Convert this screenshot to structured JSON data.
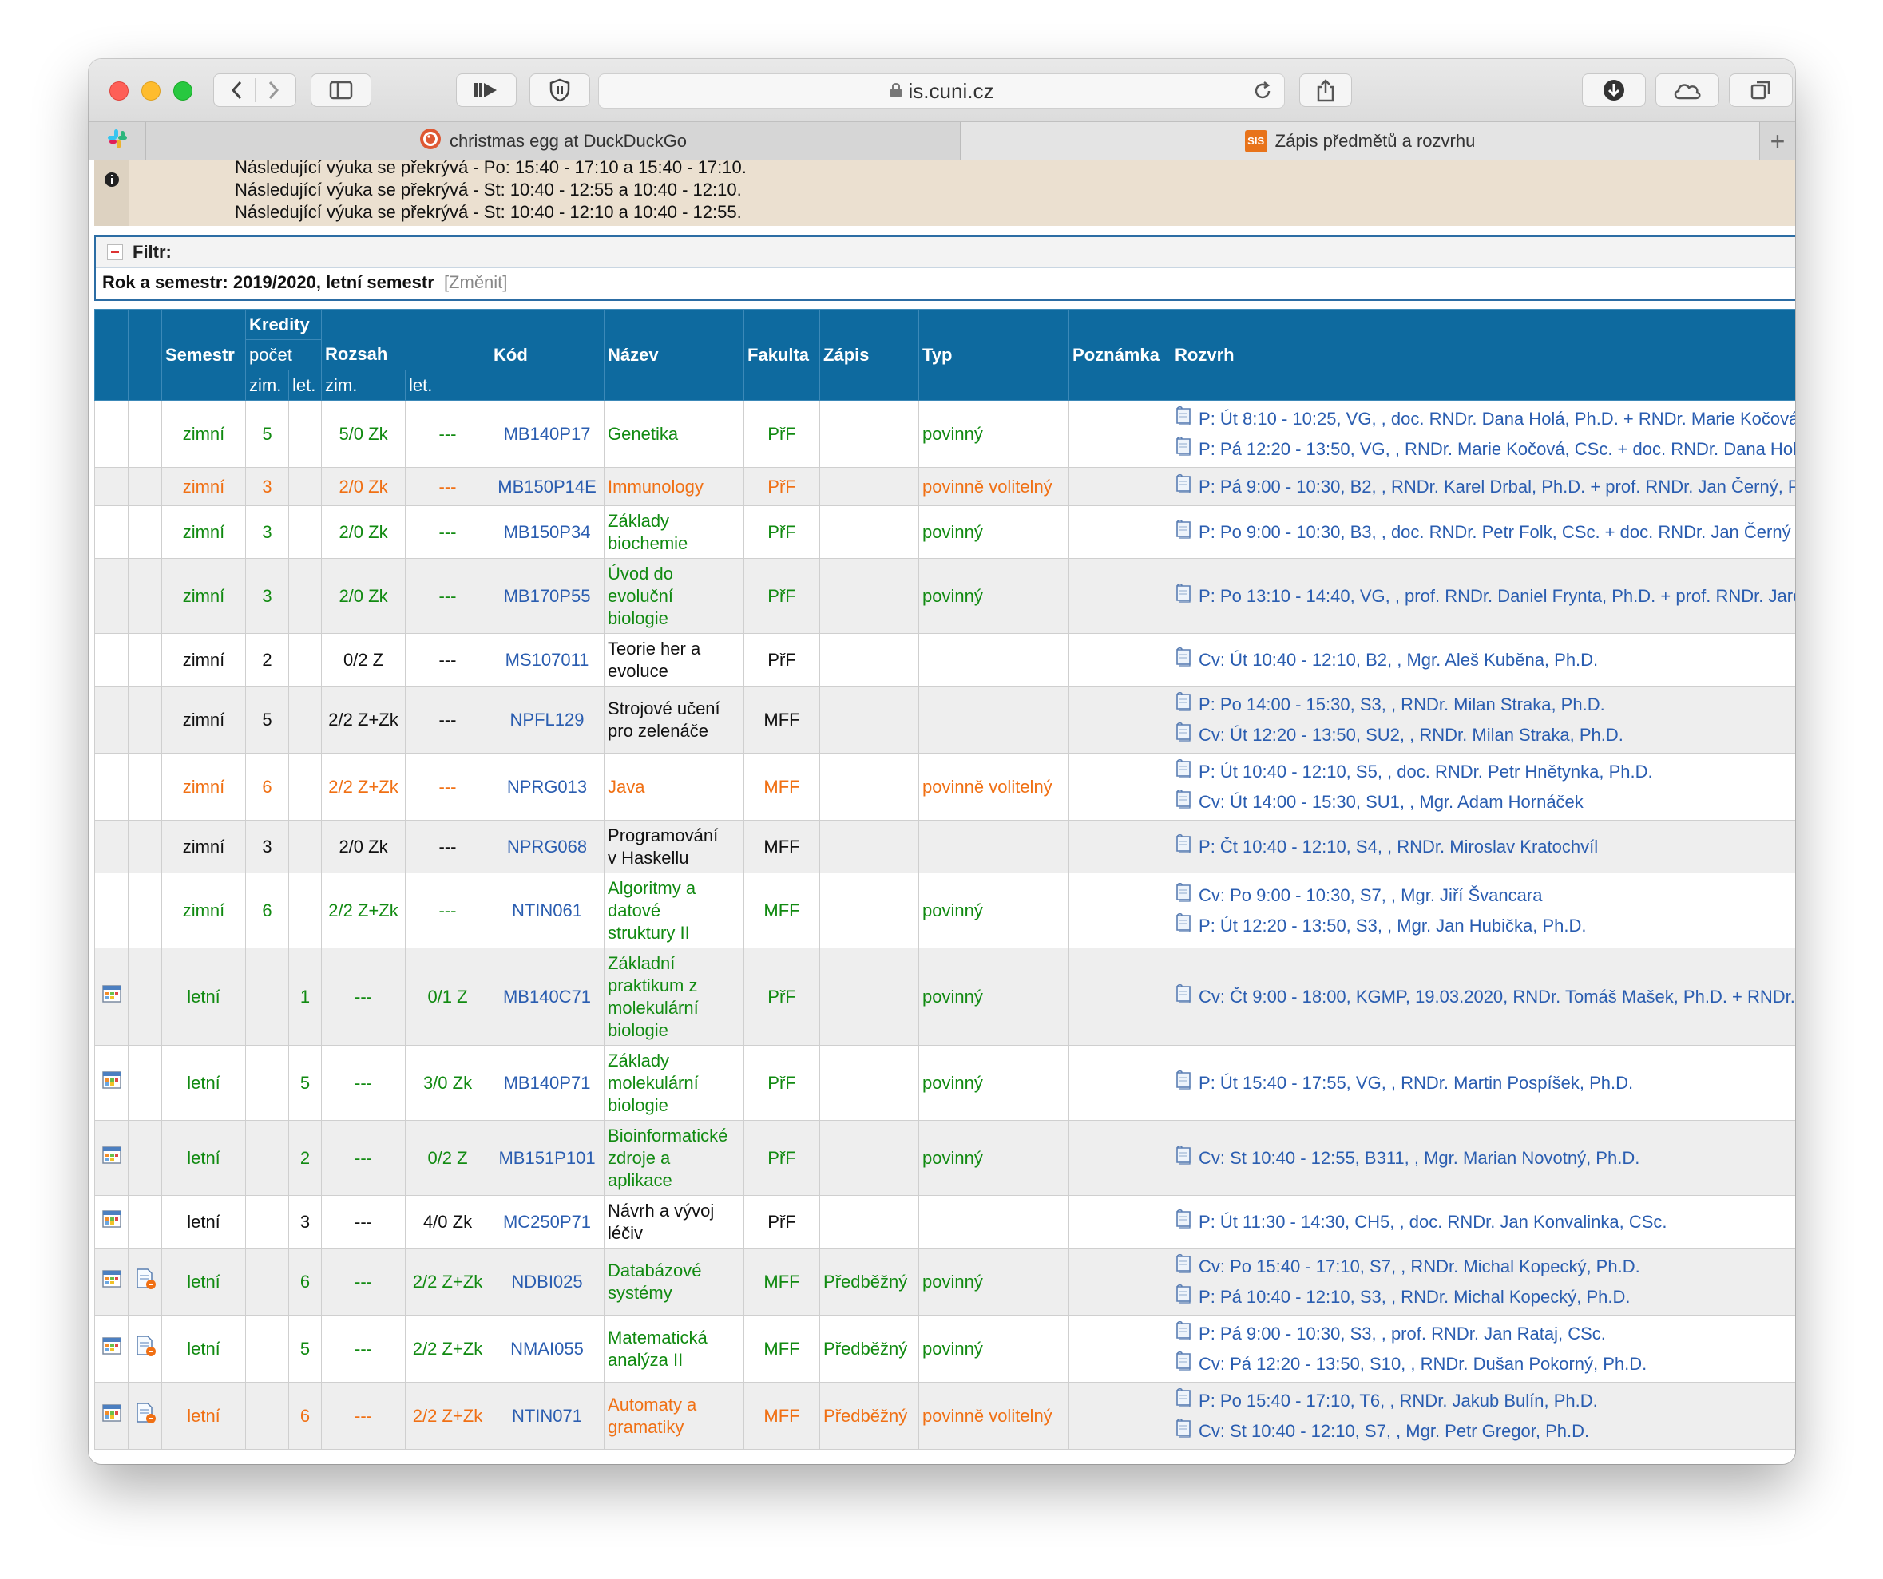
{
  "browser": {
    "url": "is.cuni.cz",
    "tabs": [
      {
        "label": "christmas egg at DuckDuckGo",
        "icon": "duckduckgo-icon"
      },
      {
        "label": "Zápis předmětů a rozvrhu",
        "icon": "sis-icon",
        "icon_text": "SIS"
      }
    ]
  },
  "messages": [
    "Následující výuka se překrývá - Po: 15:40 - 17:10 a 15:40 - 17:10.",
    "Následující výuka se překrývá - St: 10:40 - 12:55 a 10:40 - 12:10.",
    "Následující výuka se překrývá - St: 10:40 - 12:10 a 10:40 - 12:55."
  ],
  "filter": {
    "title": "Filtr:",
    "label": "Rok a semestr: 2019/2020, letní semestr",
    "change": "[Změnit]"
  },
  "table": {
    "headers": {
      "semestr": "Semestr",
      "kredity": "Kredity",
      "pocet": "počet",
      "rozsah": "Rozsah",
      "zim": "zim.",
      "let": "let.",
      "kod": "Kód",
      "nazev": "Název",
      "fakulta": "Fakulta",
      "zapis": "Zápis",
      "typ": "Typ",
      "poznamka": "Poznámka",
      "rozvrh": "Rozvrh"
    },
    "rows": [
      {
        "color": "green",
        "cal": false,
        "doc": false,
        "semestr": "zimní",
        "kr_zim": "5",
        "kr_let": "",
        "rz_zim": "5/0 Zk",
        "rz_let": "---",
        "kod": "MB140P17",
        "nazev": [
          "Genetika"
        ],
        "fakulta": "PřF",
        "zapis": "",
        "typ": "povinný",
        "pozn": "",
        "rozvrh": [
          "P: Út 8:10 - 10:25, VG, , doc. RNDr. Dana Holá, Ph.D. + RNDr. Marie Kočová, CSc.",
          "P: Pá 12:20 - 13:50, VG, , RNDr. Marie Kočová, CSc. + doc. RNDr. Dana Holá, Ph.D."
        ]
      },
      {
        "color": "orange",
        "cal": false,
        "doc": false,
        "semestr": "zimní",
        "kr_zim": "3",
        "kr_let": "",
        "rz_zim": "2/0 Zk",
        "rz_let": "---",
        "kod": "MB150P14E",
        "nazev": [
          "Immunology"
        ],
        "fakulta": "PřF",
        "zapis": "",
        "typ": "povinně volitelný",
        "pozn": "",
        "rozvrh": [
          "P: Pá 9:00 - 10:30, B2, , RNDr. Karel Drbal, Ph.D. + prof. RNDr. Jan Černý, Ph.D."
        ]
      },
      {
        "color": "green",
        "cal": false,
        "doc": false,
        "semestr": "zimní",
        "kr_zim": "3",
        "kr_let": "",
        "rz_zim": "2/0 Zk",
        "rz_let": "---",
        "kod": "MB150P34",
        "nazev": [
          "Základy",
          "biochemie"
        ],
        "fakulta": "PřF",
        "zapis": "",
        "typ": "povinný",
        "pozn": "",
        "rozvrh": [
          "P: Po 9:00 - 10:30, B3, , doc. RNDr. Petr Folk, CSc. + doc. RNDr. Jan Černý"
        ]
      },
      {
        "color": "green",
        "cal": false,
        "doc": false,
        "semestr": "zimní",
        "kr_zim": "3",
        "kr_let": "",
        "rz_zim": "2/0 Zk",
        "rz_let": "---",
        "kod": "MB170P55",
        "nazev": [
          "Úvod do",
          "evoluční",
          "biologie"
        ],
        "fakulta": "PřF",
        "zapis": "",
        "typ": "povinný",
        "pozn": "",
        "rozvrh": [
          "P: Po 13:10 - 14:40, VG, , prof. RNDr. Daniel Frynta, Ph.D. + prof. RNDr. Jaroslav Flegr"
        ]
      },
      {
        "color": "black",
        "cal": false,
        "doc": false,
        "semestr": "zimní",
        "kr_zim": "2",
        "kr_let": "",
        "rz_zim": "0/2 Z",
        "rz_let": "---",
        "kod": "MS107011",
        "nazev": [
          "Teorie her a",
          "evoluce"
        ],
        "fakulta": "PřF",
        "zapis": "",
        "typ": "",
        "pozn": "",
        "rozvrh": [
          "Cv: Út 10:40 - 12:10, B2, , Mgr. Aleš Kuběna, Ph.D."
        ]
      },
      {
        "color": "black",
        "cal": false,
        "doc": false,
        "semestr": "zimní",
        "kr_zim": "5",
        "kr_let": "",
        "rz_zim": "2/2 Z+Zk",
        "rz_let": "---",
        "kod": "NPFL129",
        "nazev": [
          "Strojové učení",
          "pro zelenáče"
        ],
        "fakulta": "MFF",
        "zapis": "",
        "typ": "",
        "pozn": "",
        "rozvrh": [
          "P: Po 14:00 - 15:30, S3, , RNDr. Milan Straka, Ph.D.",
          "Cv: Út 12:20 - 13:50, SU2, , RNDr. Milan Straka, Ph.D."
        ]
      },
      {
        "color": "orange",
        "cal": false,
        "doc": false,
        "semestr": "zimní",
        "kr_zim": "6",
        "kr_let": "",
        "rz_zim": "2/2 Z+Zk",
        "rz_let": "---",
        "kod": "NPRG013",
        "nazev": [
          "Java"
        ],
        "fakulta": "MFF",
        "zapis": "",
        "typ": "povinně volitelný",
        "pozn": "",
        "rozvrh": [
          "P: Út 10:40 - 12:10, S5, , doc. RNDr. Petr Hnětynka, Ph.D.",
          "Cv: Út 14:00 - 15:30, SU1, , Mgr. Adam Hornáček"
        ]
      },
      {
        "color": "black",
        "cal": false,
        "doc": false,
        "semestr": "zimní",
        "kr_zim": "3",
        "kr_let": "",
        "rz_zim": "2/0 Zk",
        "rz_let": "---",
        "kod": "NPRG068",
        "nazev": [
          "Programování",
          "v Haskellu"
        ],
        "fakulta": "MFF",
        "zapis": "",
        "typ": "",
        "pozn": "",
        "rozvrh": [
          "P: Čt 10:40 - 12:10, S4, , RNDr. Miroslav Kratochvíl"
        ]
      },
      {
        "color": "green",
        "cal": false,
        "doc": false,
        "semestr": "zimní",
        "kr_zim": "6",
        "kr_let": "",
        "rz_zim": "2/2 Z+Zk",
        "rz_let": "---",
        "kod": "NTIN061",
        "nazev": [
          "Algoritmy a",
          "datové",
          "struktury II"
        ],
        "fakulta": "MFF",
        "zapis": "",
        "typ": "povinný",
        "pozn": "",
        "rozvrh": [
          "Cv: Po 9:00 - 10:30, S7, , Mgr. Jiří Švancara",
          "P: Út 12:20 - 13:50, S3, , Mgr. Jan Hubička, Ph.D."
        ]
      },
      {
        "color": "green",
        "cal": true,
        "doc": false,
        "semestr": "letní",
        "kr_zim": "",
        "kr_let": "1",
        "rz_zim": "---",
        "rz_let": "0/1 Z",
        "kod": "MB140C71",
        "nazev": [
          "Základní",
          "praktikum z",
          "molekulární",
          "biologie"
        ],
        "fakulta": "PřF",
        "zapis": "",
        "typ": "povinný",
        "pozn": "",
        "rozvrh": [
          "Cv: Čt 9:00 - 18:00, KGMP, 19.03.2020, RNDr. Tomáš Mašek, Ph.D. + RNDr. Martin Pospíšek, Ph.D."
        ]
      },
      {
        "color": "green",
        "cal": true,
        "doc": false,
        "semestr": "letní",
        "kr_zim": "",
        "kr_let": "5",
        "rz_zim": "---",
        "rz_let": "3/0 Zk",
        "kod": "MB140P71",
        "nazev": [
          "Základy",
          "molekulární",
          "biologie"
        ],
        "fakulta": "PřF",
        "zapis": "",
        "typ": "povinný",
        "pozn": "",
        "rozvrh": [
          "P: Út 15:40 - 17:55, VG, , RNDr. Martin Pospíšek, Ph.D."
        ]
      },
      {
        "color": "green",
        "cal": true,
        "doc": false,
        "semestr": "letní",
        "kr_zim": "",
        "kr_let": "2",
        "rz_zim": "---",
        "rz_let": "0/2 Z",
        "kod": "MB151P101",
        "nazev": [
          "Bioinformatické",
          "zdroje a",
          "aplikace"
        ],
        "fakulta": "PřF",
        "zapis": "",
        "typ": "povinný",
        "pozn": "",
        "rozvrh": [
          "Cv: St 10:40 - 12:55, B311, , Mgr. Marian Novotný, Ph.D."
        ]
      },
      {
        "color": "black",
        "cal": true,
        "doc": false,
        "semestr": "letní",
        "kr_zim": "",
        "kr_let": "3",
        "rz_zim": "---",
        "rz_let": "4/0 Zk",
        "kod": "MC250P71",
        "nazev": [
          "Návrh a vývoj",
          "léčiv"
        ],
        "fakulta": "PřF",
        "zapis": "",
        "typ": "",
        "pozn": "",
        "rozvrh": [
          "P: Út 11:30 - 14:30, CH5, , doc. RNDr. Jan Konvalinka, CSc."
        ]
      },
      {
        "color": "green",
        "cal": true,
        "doc": true,
        "semestr": "letní",
        "kr_zim": "",
        "kr_let": "6",
        "rz_zim": "---",
        "rz_let": "2/2 Z+Zk",
        "kod": "NDBI025",
        "nazev": [
          "Databázové",
          "systémy"
        ],
        "fakulta": "MFF",
        "zapis": "Předběžný",
        "typ": "povinný",
        "pozn": "",
        "rozvrh": [
          "Cv: Po 15:40 - 17:10, S7, , RNDr. Michal Kopecký, Ph.D.",
          "P: Pá 10:40 - 12:10, S3, , RNDr. Michal Kopecký, Ph.D."
        ]
      },
      {
        "color": "green",
        "cal": true,
        "doc": true,
        "semestr": "letní",
        "kr_zim": "",
        "kr_let": "5",
        "rz_zim": "---",
        "rz_let": "2/2 Z+Zk",
        "kod": "NMAI055",
        "nazev": [
          "Matematická",
          "analýza II"
        ],
        "fakulta": "MFF",
        "zapis": "Předběžný",
        "typ": "povinný",
        "pozn": "",
        "rozvrh": [
          "P: Pá 9:00 - 10:30, S3, , prof. RNDr. Jan Rataj, CSc.",
          "Cv: Pá 12:20 - 13:50, S10, , RNDr. Dušan Pokorný, Ph.D."
        ]
      },
      {
        "color": "orange",
        "cal": true,
        "doc": true,
        "semestr": "letní",
        "kr_zim": "",
        "kr_let": "6",
        "rz_zim": "---",
        "rz_let": "2/2 Z+Zk",
        "kod": "NTIN071",
        "nazev": [
          "Automaty a",
          "gramatiky"
        ],
        "fakulta": "MFF",
        "zapis": "Předběžný",
        "typ": "povinně volitelný",
        "pozn": "",
        "rozvrh": [
          "P: Po 15:40 - 17:10, T6, , RNDr. Jakub Bulín, Ph.D.",
          "Cv: St 10:40 - 12:10, S7, , Mgr. Petr Gregor, Ph.D."
        ]
      }
    ]
  }
}
